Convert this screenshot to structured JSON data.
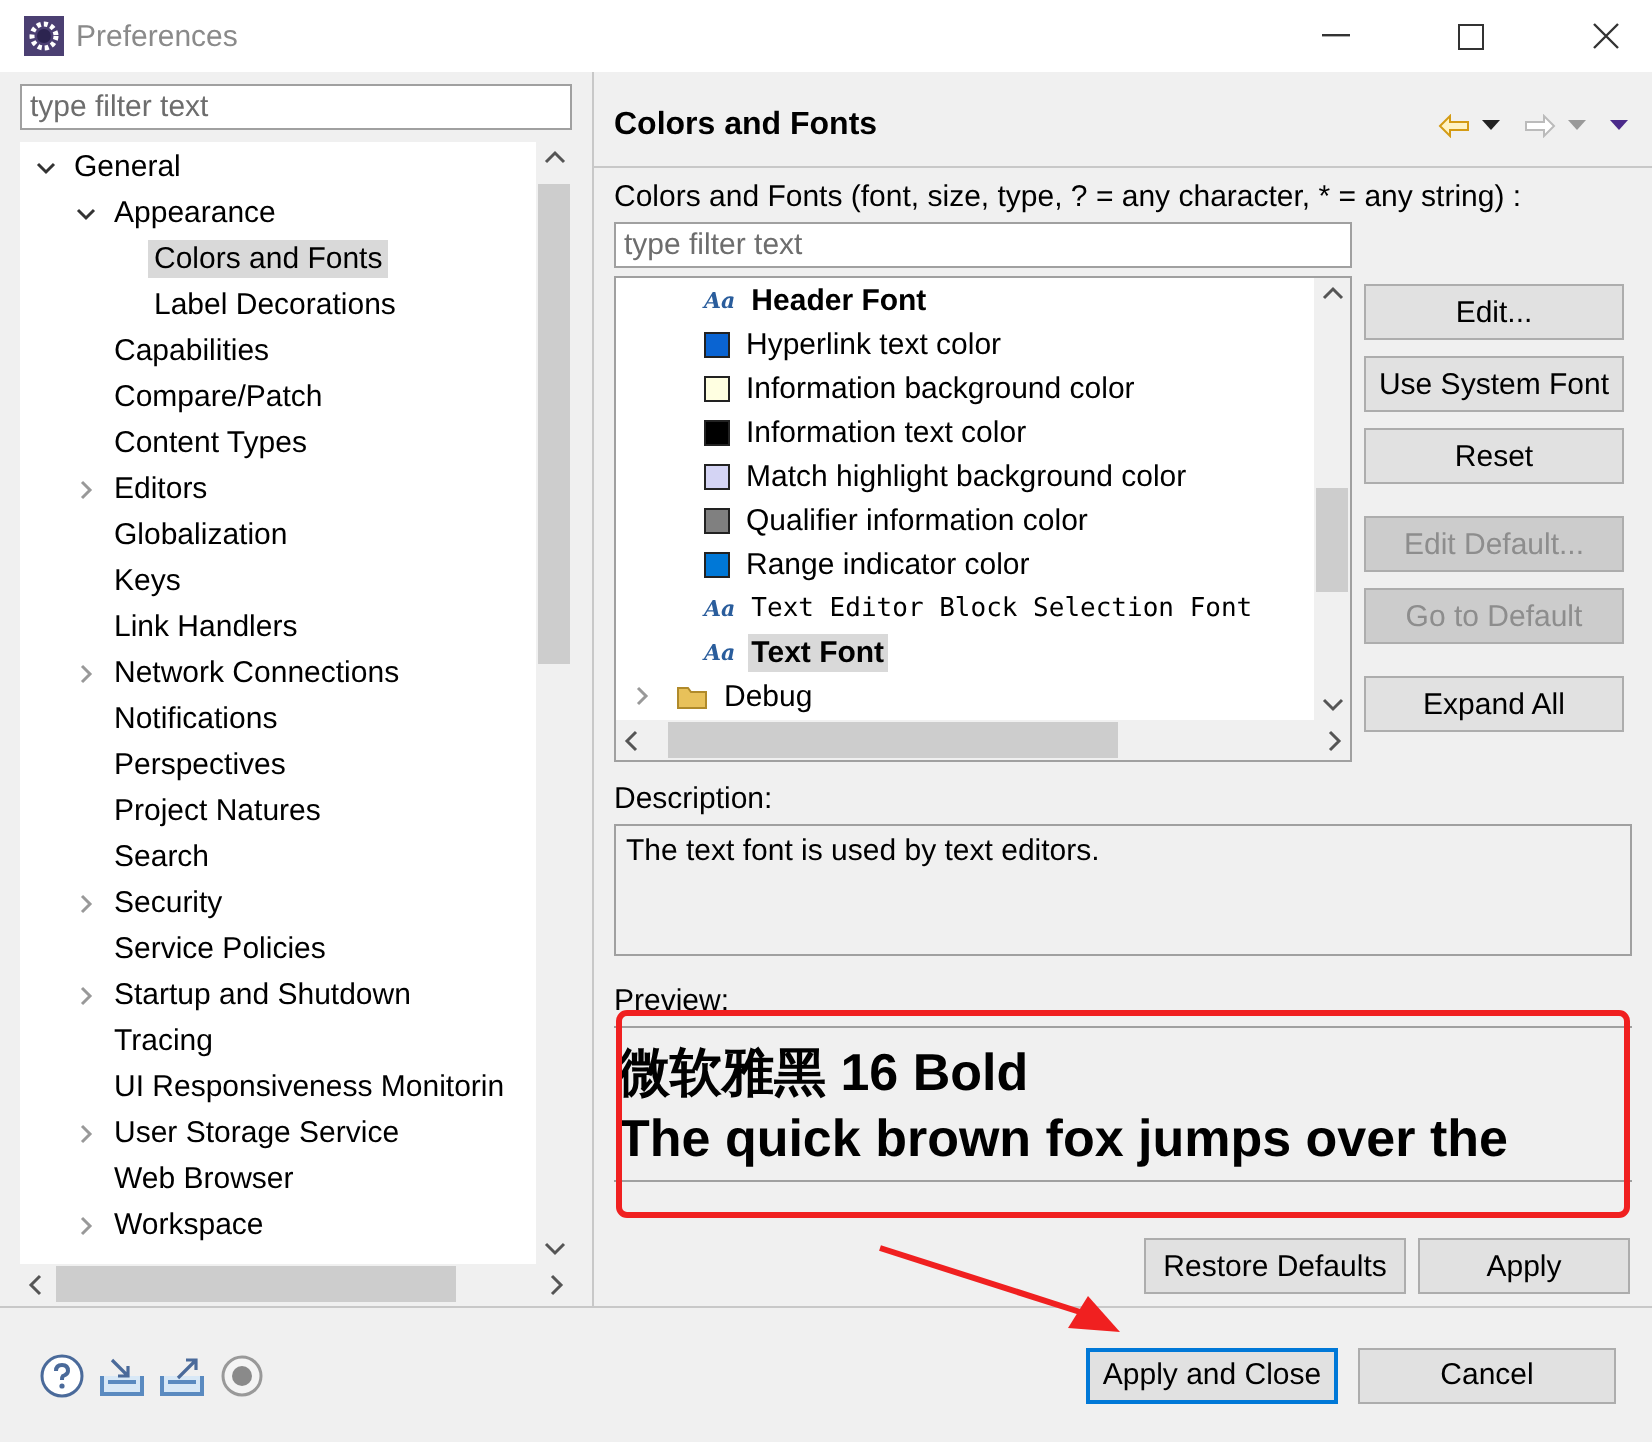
{
  "window": {
    "title": "Preferences"
  },
  "left": {
    "filter": {
      "placeholder": "type filter text"
    },
    "tree": [
      {
        "label": "General",
        "expanded": true,
        "selected": false,
        "children": [
          {
            "label": "Appearance",
            "expanded": true,
            "selected": false,
            "children": [
              {
                "label": "Colors and Fonts",
                "selected": true
              },
              {
                "label": "Label Decorations",
                "selected": false
              }
            ]
          },
          {
            "label": "Capabilities",
            "selected": false
          },
          {
            "label": "Compare/Patch",
            "selected": false
          },
          {
            "label": "Content Types",
            "selected": false
          },
          {
            "label": "Editors",
            "expanded": false,
            "selected": false
          },
          {
            "label": "Globalization",
            "selected": false
          },
          {
            "label": "Keys",
            "selected": false
          },
          {
            "label": "Link Handlers",
            "selected": false
          },
          {
            "label": "Network Connections",
            "expanded": false,
            "selected": false
          },
          {
            "label": "Notifications",
            "selected": false
          },
          {
            "label": "Perspectives",
            "selected": false
          },
          {
            "label": "Project Natures",
            "selected": false
          },
          {
            "label": "Search",
            "selected": false
          },
          {
            "label": "Security",
            "expanded": false,
            "selected": false
          },
          {
            "label": "Service Policies",
            "selected": false
          },
          {
            "label": "Startup and Shutdown",
            "expanded": false,
            "selected": false
          },
          {
            "label": "Tracing",
            "selected": false
          },
          {
            "label": "UI Responsiveness Monitorin",
            "selected": false
          },
          {
            "label": "User Storage Service",
            "expanded": false,
            "selected": false
          },
          {
            "label": "Web Browser",
            "selected": false
          },
          {
            "label": "Workspace",
            "expanded": false,
            "selected": false
          }
        ]
      }
    ]
  },
  "right": {
    "title": "Colors and Fonts",
    "filter_label": "Colors and Fonts (font, size, type, ? = any character, * = any string) :",
    "filter": {
      "placeholder": "type filter text"
    },
    "items": [
      {
        "kind": "boldfont",
        "glyph": "Aa",
        "label": "Header Font",
        "selected": false
      },
      {
        "kind": "color",
        "color": "#0a64d2",
        "label": "Hyperlink text color",
        "selected": false
      },
      {
        "kind": "color",
        "color": "#ffffe1",
        "label": "Information background color",
        "selected": false
      },
      {
        "kind": "color",
        "color": "#000000",
        "label": "Information text color",
        "selected": false
      },
      {
        "kind": "color",
        "color": "#d4d4f4",
        "label": "Match highlight background color",
        "selected": false
      },
      {
        "kind": "color",
        "color": "#808080",
        "label": "Qualifier information color",
        "selected": false
      },
      {
        "kind": "color",
        "color": "#0078d7",
        "label": "Range indicator color",
        "selected": false
      },
      {
        "kind": "monofont",
        "glyph": "Aa",
        "label": "Text Editor Block Selection Font",
        "selected": false
      },
      {
        "kind": "boldfont",
        "glyph": "Aa",
        "label": "Text Font",
        "selected": true
      },
      {
        "kind": "category",
        "label": "Debug",
        "expanded": false,
        "selected": false
      }
    ],
    "buttons": [
      {
        "label": "Edit...",
        "disabled": false
      },
      {
        "label": "Use System Font",
        "disabled": false
      },
      {
        "label": "Reset",
        "disabled": false
      },
      {
        "label": "Edit Default...",
        "disabled": true
      },
      {
        "label": "Go to Default",
        "disabled": true
      },
      {
        "label": "Expand All",
        "disabled": false
      }
    ],
    "description": {
      "label": "Description:",
      "text": "The text font is used by text editors."
    },
    "preview": {
      "label": "Preview:",
      "lines": [
        "微软雅黑 16 Bold",
        "The quick brown fox jumps over the"
      ]
    },
    "page_buttons": [
      "Restore Defaults",
      "Apply"
    ]
  },
  "footer": {
    "buttons": [
      {
        "label": "Apply and Close",
        "default": true
      },
      {
        "label": "Cancel",
        "default": false
      }
    ]
  },
  "annotations": [
    {
      "kind": "box"
    },
    {
      "kind": "arrow"
    }
  ]
}
